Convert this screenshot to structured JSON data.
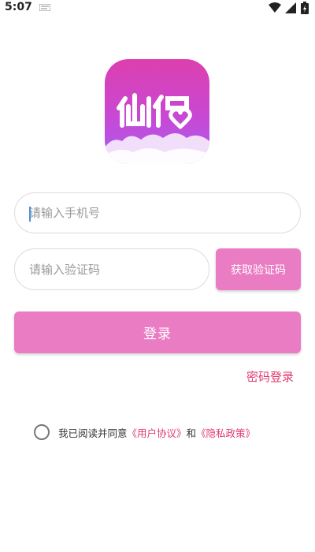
{
  "status_bar": {
    "time": "5:07",
    "icons": [
      "notification-icon",
      "wifi-icon",
      "signal-icon",
      "battery-icon"
    ]
  },
  "logo": {
    "text": "仙侣",
    "icon": "app-logo"
  },
  "phone_input": {
    "placeholder": "请输入手机号",
    "value": ""
  },
  "code_input": {
    "placeholder": "请输入验证码",
    "value": ""
  },
  "get_code_button": {
    "label": "获取验证码"
  },
  "login_button": {
    "label": "登录"
  },
  "password_login_link": {
    "label": "密码登录"
  },
  "agreement": {
    "prefix": "我已阅读并同意",
    "user_agreement": "《用户协议》",
    "and": "和",
    "privacy_policy": "《隐私政策》",
    "checked": false
  },
  "colors": {
    "accent": "#ea7cc3",
    "link": "#e03a6e",
    "logo_gradient_top": "#dd3fae",
    "logo_gradient_bottom": "#a95ef0"
  }
}
